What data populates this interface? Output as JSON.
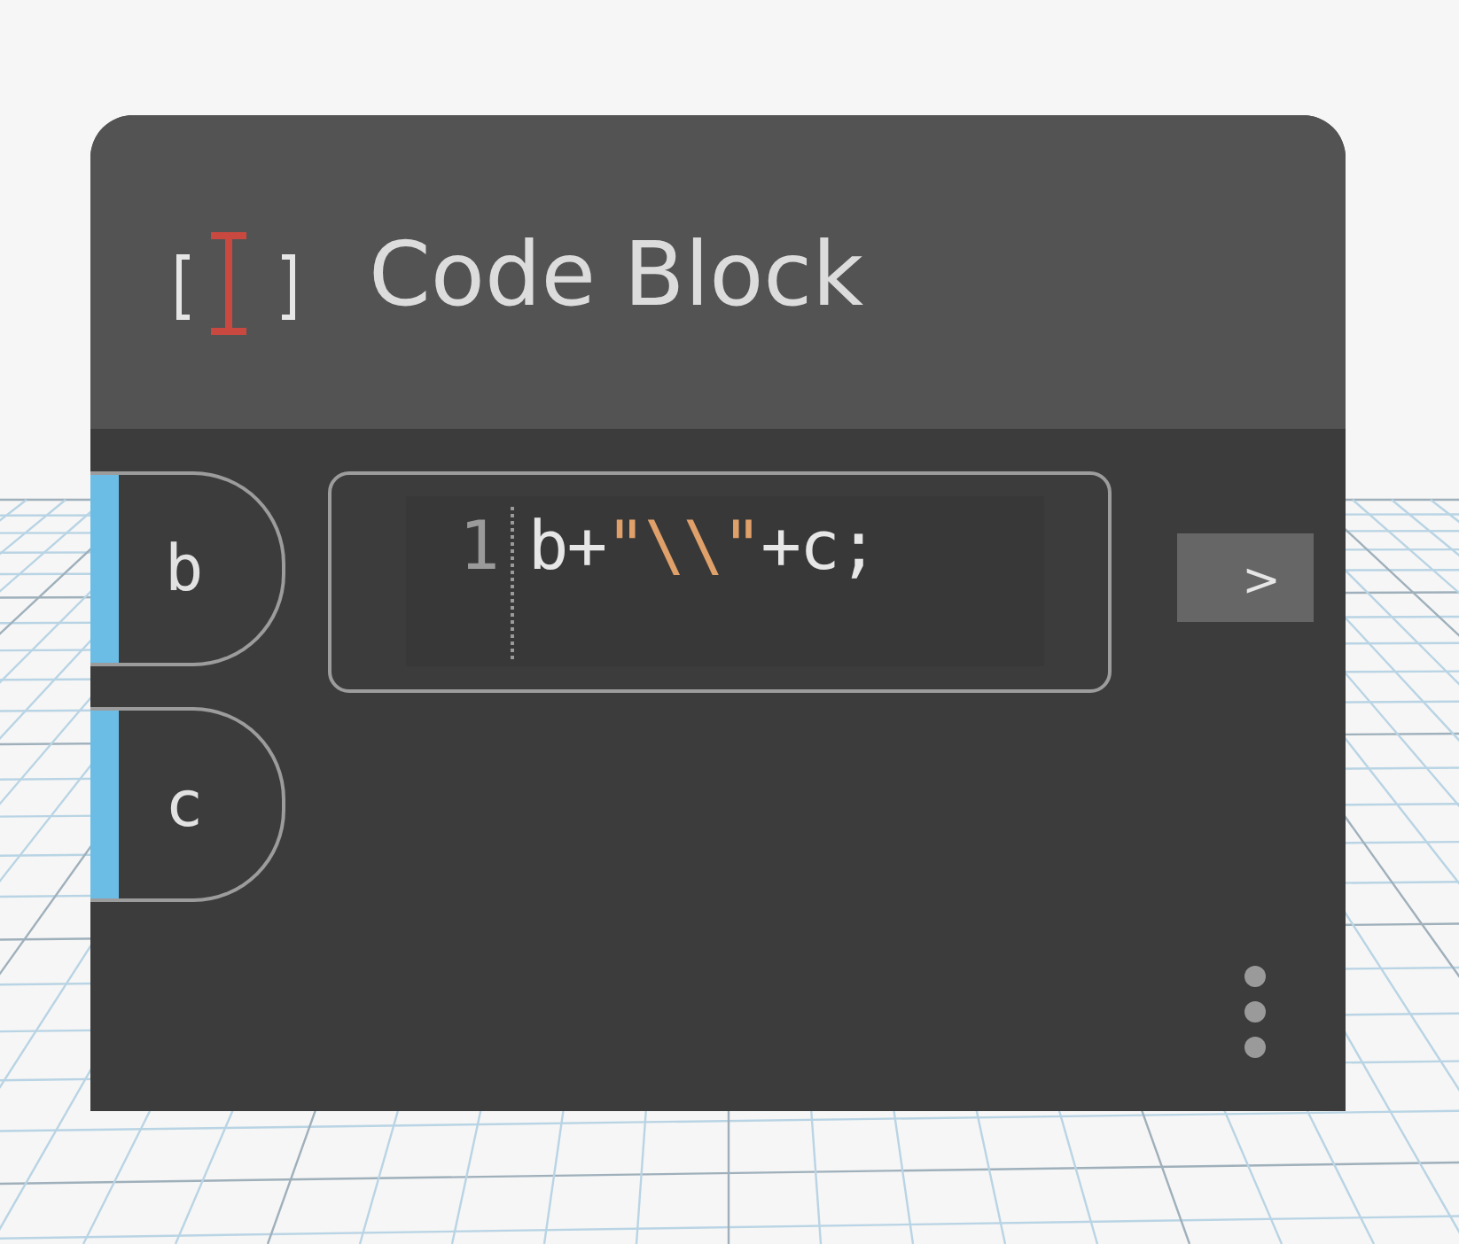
{
  "node": {
    "title": "Code Block",
    "inputs": [
      {
        "label": "b"
      },
      {
        "label": "c"
      }
    ],
    "lines": [
      {
        "number": "1",
        "tokens": [
          {
            "kind": "plain",
            "text": "b+"
          },
          {
            "kind": "string",
            "text": "\"\\\\\""
          },
          {
            "kind": "plain",
            "text": "+c;"
          }
        ]
      }
    ],
    "output_port": ">"
  }
}
